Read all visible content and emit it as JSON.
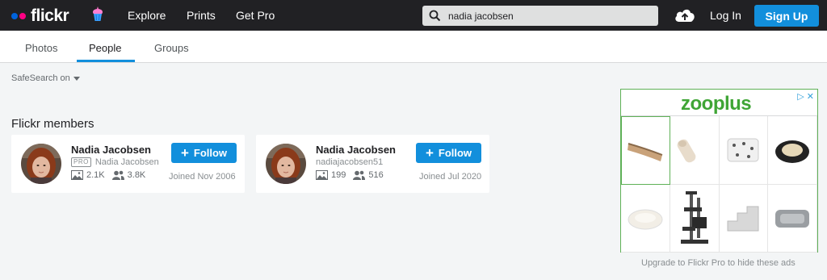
{
  "header": {
    "logo": "flickr",
    "nav": [
      "Explore",
      "Prints",
      "Get Pro"
    ],
    "search_value": "nadia jacobsen",
    "login": "Log In",
    "signup": "Sign Up"
  },
  "tabs": [
    "Photos",
    "People",
    "Groups"
  ],
  "active_tab": "People",
  "safesearch": "SafeSearch on",
  "section_title": "Flickr members",
  "members": [
    {
      "name": "Nadia Jacobsen",
      "pro": "PRO",
      "username": "Nadia Jacobsen",
      "photos": "2.1K",
      "followers": "3.8K",
      "follow": "Follow",
      "joined": "Joined Nov 2006"
    },
    {
      "name": "Nadia Jacobsen",
      "pro": "",
      "username": "nadiajacobsen51",
      "photos": "199",
      "followers": "516",
      "follow": "Follow",
      "joined": "Joined Jul 2020"
    }
  ],
  "ad": {
    "brand": "zooplus",
    "upgrade_note": "Upgrade to Flickr Pro to hide these ads"
  },
  "colors": {
    "accent": "#128fdc",
    "topbar": "#212124",
    "brand_blue": "#0063dc",
    "brand_pink": "#ff0084",
    "ad_green": "#3fa535"
  }
}
